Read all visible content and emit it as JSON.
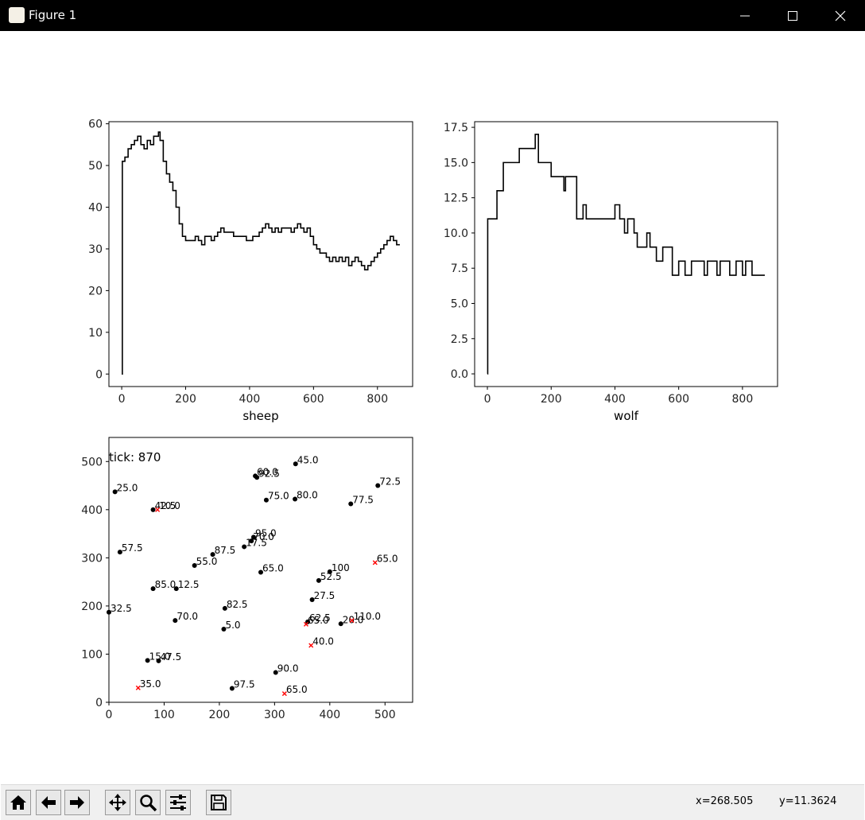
{
  "window": {
    "title": "Figure 1"
  },
  "toolbar": {
    "buttons": [
      "home-icon",
      "back-icon",
      "forward-icon",
      "pan-icon",
      "zoom-icon",
      "configure-icon",
      "save-icon"
    ],
    "x_readout": "x=268.505",
    "y_readout": "y=11.3624"
  },
  "colors": {
    "line": "#000000",
    "agent_black": "#000000",
    "agent_red": "#ff0000"
  },
  "chart_data": [
    {
      "type": "line",
      "title": "",
      "xlabel": "sheep",
      "ylabel": "",
      "xlim": [
        -40,
        910
      ],
      "ylim": [
        -3,
        60.5
      ],
      "xticks": [
        0,
        200,
        400,
        600,
        800
      ],
      "yticks": [
        0,
        10,
        20,
        30,
        40,
        50,
        60
      ],
      "grid": false,
      "step": true,
      "series": [
        {
          "values": [
            [
              0,
              0
            ],
            [
              2,
              51
            ],
            [
              10,
              52
            ],
            [
              20,
              54
            ],
            [
              30,
              55
            ],
            [
              40,
              56
            ],
            [
              50,
              57
            ],
            [
              60,
              55
            ],
            [
              70,
              54
            ],
            [
              80,
              56
            ],
            [
              90,
              55
            ],
            [
              100,
              57
            ],
            [
              110,
              57
            ],
            [
              115,
              58
            ],
            [
              120,
              56
            ],
            [
              130,
              51
            ],
            [
              140,
              48
            ],
            [
              150,
              46
            ],
            [
              160,
              44
            ],
            [
              170,
              40
            ],
            [
              180,
              36
            ],
            [
              190,
              33
            ],
            [
              200,
              32
            ],
            [
              220,
              32
            ],
            [
              230,
              33
            ],
            [
              240,
              32
            ],
            [
              250,
              31
            ],
            [
              260,
              33
            ],
            [
              280,
              32
            ],
            [
              290,
              33
            ],
            [
              300,
              34
            ],
            [
              310,
              35
            ],
            [
              320,
              34
            ],
            [
              340,
              34
            ],
            [
              350,
              33
            ],
            [
              370,
              33
            ],
            [
              390,
              32
            ],
            [
              410,
              33
            ],
            [
              420,
              33
            ],
            [
              430,
              34
            ],
            [
              440,
              35
            ],
            [
              450,
              36
            ],
            [
              460,
              35
            ],
            [
              470,
              34
            ],
            [
              480,
              35
            ],
            [
              490,
              34
            ],
            [
              500,
              35
            ],
            [
              520,
              35
            ],
            [
              530,
              34
            ],
            [
              540,
              35
            ],
            [
              550,
              36
            ],
            [
              560,
              35
            ],
            [
              570,
              34
            ],
            [
              580,
              35
            ],
            [
              590,
              33
            ],
            [
              600,
              31
            ],
            [
              610,
              30
            ],
            [
              620,
              29
            ],
            [
              640,
              28
            ],
            [
              650,
              27
            ],
            [
              660,
              28
            ],
            [
              670,
              27
            ],
            [
              680,
              28
            ],
            [
              690,
              27
            ],
            [
              700,
              28
            ],
            [
              710,
              26
            ],
            [
              720,
              27
            ],
            [
              730,
              28
            ],
            [
              740,
              27
            ],
            [
              750,
              26
            ],
            [
              760,
              25
            ],
            [
              770,
              26
            ],
            [
              780,
              27
            ],
            [
              790,
              28
            ],
            [
              800,
              29
            ],
            [
              810,
              30
            ],
            [
              820,
              31
            ],
            [
              830,
              32
            ],
            [
              840,
              33
            ],
            [
              850,
              32
            ],
            [
              860,
              31
            ],
            [
              870,
              31
            ]
          ]
        }
      ]
    },
    {
      "type": "line",
      "title": "",
      "xlabel": "wolf",
      "ylabel": "",
      "xlim": [
        -40,
        910
      ],
      "ylim": [
        -0.9,
        17.9
      ],
      "xticks": [
        0,
        200,
        400,
        600,
        800
      ],
      "yticks": [
        0.0,
        2.5,
        5.0,
        7.5,
        10.0,
        12.5,
        15.0,
        17.5
      ],
      "grid": false,
      "step": true,
      "series": [
        {
          "values": [
            [
              0,
              0
            ],
            [
              1,
              11
            ],
            [
              30,
              13
            ],
            [
              50,
              15
            ],
            [
              100,
              16
            ],
            [
              140,
              16
            ],
            [
              150,
              17
            ],
            [
              160,
              15
            ],
            [
              200,
              14
            ],
            [
              240,
              13
            ],
            [
              245,
              14
            ],
            [
              260,
              14
            ],
            [
              280,
              11
            ],
            [
              300,
              12
            ],
            [
              310,
              11
            ],
            [
              400,
              12
            ],
            [
              415,
              11
            ],
            [
              430,
              10
            ],
            [
              440,
              11
            ],
            [
              460,
              10
            ],
            [
              470,
              9
            ],
            [
              490,
              9
            ],
            [
              500,
              10
            ],
            [
              510,
              9
            ],
            [
              530,
              8
            ],
            [
              550,
              9
            ],
            [
              580,
              7
            ],
            [
              600,
              8
            ],
            [
              620,
              7
            ],
            [
              640,
              8
            ],
            [
              680,
              7
            ],
            [
              690,
              8
            ],
            [
              720,
              7
            ],
            [
              730,
              8
            ],
            [
              760,
              7
            ],
            [
              780,
              8
            ],
            [
              800,
              7
            ],
            [
              810,
              8
            ],
            [
              830,
              7
            ],
            [
              870,
              7
            ]
          ]
        }
      ]
    },
    {
      "type": "scatter",
      "title": "",
      "xlabel": "",
      "ylabel": "",
      "xlim": [
        0,
        550
      ],
      "ylim": [
        0,
        550
      ],
      "xticks": [
        0,
        100,
        200,
        300,
        400,
        500
      ],
      "yticks": [
        0,
        100,
        200,
        300,
        400,
        500
      ],
      "grid": false,
      "annotation": "tick: 870",
      "series": [
        {
          "name": "sheep",
          "marker": "dot",
          "color": "#000000",
          "points": [
            {
              "x": 265,
              "y": 470,
              "label": "60.0"
            },
            {
              "x": 268,
              "y": 467,
              "label": "92.5"
            },
            {
              "x": 338,
              "y": 495,
              "label": "45.0"
            },
            {
              "x": 487,
              "y": 450,
              "label": "72.5"
            },
            {
              "x": 11,
              "y": 437,
              "label": "25.0"
            },
            {
              "x": 80,
              "y": 400,
              "label": "42.5"
            },
            {
              "x": 285,
              "y": 420,
              "label": "75.0"
            },
            {
              "x": 337,
              "y": 422,
              "label": "80.0"
            },
            {
              "x": 438,
              "y": 412,
              "label": "77.5"
            },
            {
              "x": 20,
              "y": 312,
              "label": "57.5"
            },
            {
              "x": 262,
              "y": 343,
              "label": "95.0"
            },
            {
              "x": 258,
              "y": 335,
              "label": "70.0"
            },
            {
              "x": 245,
              "y": 323,
              "label": "17.5"
            },
            {
              "x": 188,
              "y": 307,
              "label": "87.5"
            },
            {
              "x": 155,
              "y": 284,
              "label": "55.0"
            },
            {
              "x": 275,
              "y": 270,
              "label": "65.0"
            },
            {
              "x": 400,
              "y": 271,
              "label": "100"
            },
            {
              "x": 380,
              "y": 253,
              "label": "52.5"
            },
            {
              "x": 80,
              "y": 236,
              "label": "85.0"
            },
            {
              "x": 122,
              "y": 236,
              "label": "12.5"
            },
            {
              "x": 368,
              "y": 213,
              "label": "27.5"
            },
            {
              "x": 0,
              "y": 187,
              "label": "32.5"
            },
            {
              "x": 210,
              "y": 195,
              "label": "82.5"
            },
            {
              "x": 120,
              "y": 170,
              "label": "70.0"
            },
            {
              "x": 208,
              "y": 152,
              "label": "5.0"
            },
            {
              "x": 360,
              "y": 167,
              "label": "62.5"
            },
            {
              "x": 420,
              "y": 163,
              "label": "20.0"
            },
            {
              "x": 70,
              "y": 87,
              "label": "15.0"
            },
            {
              "x": 90,
              "y": 86,
              "label": "47.5"
            },
            {
              "x": 302,
              "y": 62,
              "label": "90.0"
            },
            {
              "x": 223,
              "y": 29,
              "label": "97.5"
            }
          ]
        },
        {
          "name": "wolf",
          "marker": "x",
          "color": "#ff0000",
          "points": [
            {
              "x": 88,
              "y": 400,
              "label": "10.0"
            },
            {
              "x": 482,
              "y": 290,
              "label": "65.0"
            },
            {
              "x": 357,
              "y": 162,
              "label": "65.0"
            },
            {
              "x": 440,
              "y": 170,
              "label": "110.0"
            },
            {
              "x": 366,
              "y": 118,
              "label": "40.0"
            },
            {
              "x": 53,
              "y": 30,
              "label": "35.0"
            },
            {
              "x": 318,
              "y": 18,
              "label": "65.0"
            }
          ]
        }
      ]
    }
  ]
}
